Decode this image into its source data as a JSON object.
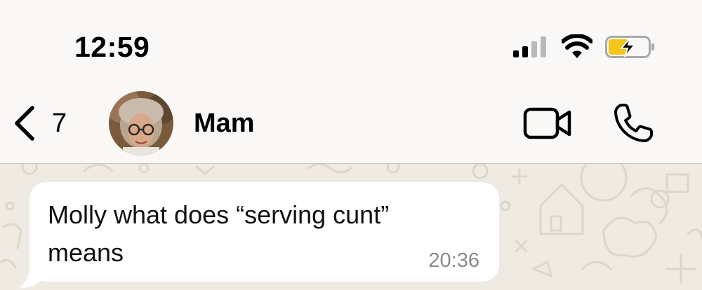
{
  "status_bar": {
    "time": "12:59",
    "icons": [
      "cellular-signal-icon",
      "wifi-icon",
      "battery-charging-icon"
    ],
    "battery_color": "#f5c518"
  },
  "header": {
    "back_count": "7",
    "contact_name": "Mam",
    "icons": [
      "back-chevron-icon",
      "video-call-icon",
      "phone-icon"
    ]
  },
  "messages": [
    {
      "direction": "incoming",
      "line1": "Molly what does “serving cunt”",
      "line2": "means",
      "time": "20:36"
    }
  ],
  "colors": {
    "chat_background": "#efeae2",
    "bubble": "#ffffff",
    "timestamp": "#8a8a8a"
  }
}
